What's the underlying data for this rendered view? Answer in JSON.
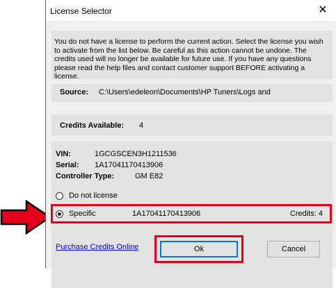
{
  "window": {
    "title": "License Selector",
    "close_glyph": "✕"
  },
  "intro_text": "You do not have a license to perform the current action. Select the license you wish to activate from the list below. Be careful as this action cannot be undone. The credits used will no longer be available for future use. If you have any questions please read the help files and contact customer support BEFORE activating a license.",
  "source": {
    "label": "Source:",
    "value": "C:\\Users\\edeleon\\Documents\\HP Tuners\\Logs and"
  },
  "credits": {
    "label": "Credits Available:",
    "value": "4"
  },
  "vehicle": {
    "vin_label": "VIN:",
    "vin_value": "1GCGSCEN3H1211536",
    "serial_label": "Serial:",
    "serial_value": "1A17041170413906",
    "controller_label": "Controller Type:",
    "controller_value": "GM E82"
  },
  "options": {
    "do_not_license": "Do not license",
    "specific_label": "Specific",
    "specific_serial": "1A17041170413906",
    "specific_credits": "Credits: 4",
    "selected": "Specific"
  },
  "footer": {
    "purchase_link": "Purchase Credits Online",
    "ok_label": "Ok",
    "cancel_label": "Cancel"
  },
  "annotation_color": "#e3001b"
}
